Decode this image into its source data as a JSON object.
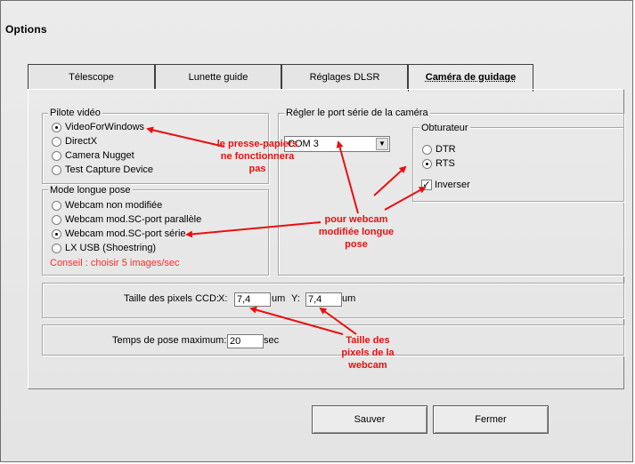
{
  "window": {
    "title": "Options"
  },
  "tabs": [
    {
      "label": "Télescope",
      "active": false
    },
    {
      "label": "Lunette guide",
      "active": false
    },
    {
      "label": "Réglages DLSR",
      "active": false
    },
    {
      "label": "Caméra de guidage",
      "active": true
    }
  ],
  "video_driver": {
    "legend": "Pilote vidéo",
    "options": [
      "VideoForWindows",
      "DirectX",
      "Camera Nugget",
      "Test Capture Device"
    ],
    "selected": "VideoForWindows"
  },
  "long_exposure": {
    "legend": "Mode longue pose",
    "options": [
      "Webcam non modifiée",
      "Webcam mod.SC-port parallèle",
      "Webcam mod.SC-port série",
      "LX USB (Shoestring)"
    ],
    "selected": "Webcam mod.SC-port série",
    "advice": "Conseil : choisir 5 images/sec"
  },
  "serial_port": {
    "legend": "Régler le port série de la caméra",
    "port": "COM 3",
    "shutter": {
      "legend": "Obturateur",
      "options": [
        "DTR",
        "RTS"
      ],
      "selected": "RTS",
      "invert_label": "Inverser",
      "invert_checked": true
    }
  },
  "ccd": {
    "label": "Taille des pixels CCD:",
    "x_label": "X:",
    "x_value": "7,4",
    "x_unit": "um",
    "y_label": "Y:",
    "y_value": "7,4",
    "y_unit": "um"
  },
  "exposure": {
    "label": "Temps de pose maximum:",
    "value": "20",
    "unit": "sec"
  },
  "buttons": {
    "save": "Sauver",
    "close": "Fermer"
  },
  "annotations": {
    "clipboard": "le presse-papiers ne fonctionnera pas",
    "webcam_mod": "pour webcam modifiée longue pose",
    "pixels": "Taille des pixels de la webcam",
    "color": "#e81010"
  }
}
